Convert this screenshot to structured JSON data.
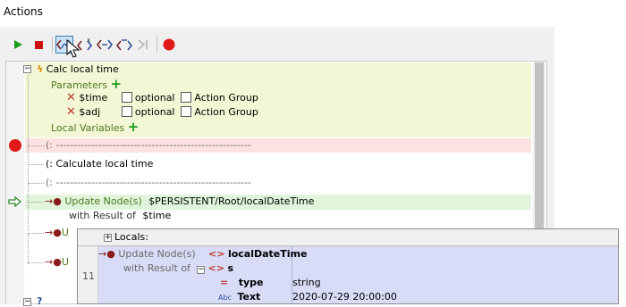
{
  "window": {
    "title": "Actions"
  },
  "toolbar": {
    "buttons": [
      {
        "name": "run-button",
        "icon": "play-icon",
        "color": "#1a9e1a"
      },
      {
        "name": "stop-button",
        "icon": "stop-icon",
        "color": "#d01010"
      },
      {
        "name": "step-into-button",
        "icon": "step-into-icon",
        "active": true
      },
      {
        "name": "step-out-button",
        "icon": "step-out-icon"
      },
      {
        "name": "step-over-button",
        "icon": "step-over-icon"
      },
      {
        "name": "step-back-button",
        "icon": "step-back-icon"
      },
      {
        "name": "run-to-cursor-button",
        "icon": "run-to-cursor-icon",
        "disabled": true
      },
      {
        "name": "toggle-breakpoint-button",
        "icon": "breakpoint-icon",
        "color": "#e11818"
      }
    ]
  },
  "editor": {
    "action_title": "Calc local time",
    "parameters_label": "Parameters",
    "params": [
      {
        "name": "$time",
        "optional_label": "optional",
        "group_label": "Action Group"
      },
      {
        "name": "$adj",
        "optional_label": "optional",
        "group_label": "Action Group"
      }
    ],
    "local_variables_label": "Local Variables",
    "comment1": "(:  -------------------------------------------------------",
    "comment2": "(:  Calculate local time",
    "comment3": "(:  -------------------------------------------------------",
    "update_label": "Update Node(s)",
    "update_path": "$PERSISTENT/Root/localDateTime",
    "with_result_label": "with Result of",
    "with_result_value": "$time",
    "truncated_label": "U"
  },
  "popup": {
    "header_label": "Locals:",
    "line_number": "11",
    "update_label": "Update Node(s)",
    "with_result_label": "with Result of",
    "local_name": "localDateTime",
    "var_name": "s",
    "type_label": "type",
    "type_value": "string",
    "text_label": "Text",
    "text_value": "2020-07-29 20:00:00",
    "abc_badge": "Abc",
    "equals_badge": "="
  },
  "colors": {
    "highlight_action": "#f3f7d5",
    "highlight_breakpoint": "#fde2e2",
    "highlight_current": "#e0f5dc",
    "popup_body": "#d8dcf6",
    "accent_green": "#4a7a1d",
    "breakpoint_red": "#e11818"
  }
}
